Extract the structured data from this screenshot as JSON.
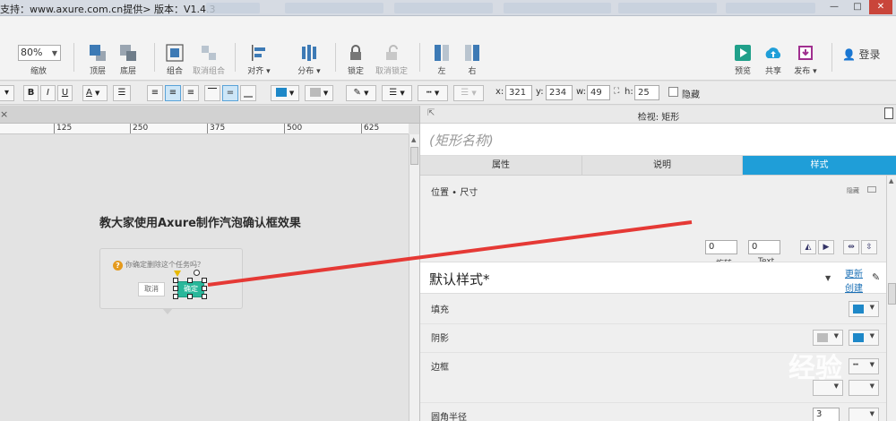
{
  "titlebar": {
    "text": "支持：www.axure.com.cn提供> 版本：V1.4.3",
    "window_controls": [
      "—",
      "□",
      "✕"
    ]
  },
  "toolbar": {
    "zoom_value": "80%",
    "zoom_label": "缩放",
    "buttons": {
      "top_layer": "顶层",
      "bottom_layer": "底层",
      "group": "组合",
      "ungroup": "取消组合",
      "align": "对齐 ▾",
      "distribute": "分布 ▾",
      "lock": "锁定",
      "unlock": "取消锁定",
      "left": "左",
      "right": "右",
      "preview": "预览",
      "share": "共享",
      "publish": "发布 ▾",
      "login": "登录"
    }
  },
  "formatbar": {
    "bold": "B",
    "italic": "I",
    "underline": "U",
    "font_color": "A",
    "x_label": "x:",
    "x_value": "321",
    "y_label": "y:",
    "y_value": "234",
    "w_label": "w:",
    "w_value": "49",
    "h_label": "h:",
    "h_value": "25",
    "hidden_label": "隐藏",
    "accent_color": "#1e88c8"
  },
  "canvas": {
    "tab_close": "×",
    "ruler_labels": [
      "125",
      "250",
      "375",
      "500",
      "625"
    ],
    "heading": "教大家使用Axure制作汽泡确认框效果",
    "bubble_text": "你确定删除这个任务吗？",
    "question_icon": "?",
    "cancel_label": "取消",
    "confirm_label": "确定",
    "confirm_color": "#29b79a"
  },
  "inspector": {
    "title": "检视: 矩形",
    "name_placeholder": "(矩形名称)",
    "tabs": [
      "属性",
      "说明",
      "样式"
    ],
    "active_tab": "样式",
    "active_color": "#1f9ed8",
    "position_size_label": "位置 • 尺寸",
    "hide_label": "隐藏",
    "rotate_value": "0",
    "rotate_label": "旋转",
    "text_rotate_value": "0",
    "text_rotate_label": "Text",
    "default_style": "默认样式*",
    "update_link": "更新",
    "create_link": "创建",
    "fill_label": "填充",
    "shadow_label": "阴影",
    "border_label": "边框",
    "radius_label": "圆角半径",
    "radius_value": "3"
  },
  "watermark": "经验"
}
